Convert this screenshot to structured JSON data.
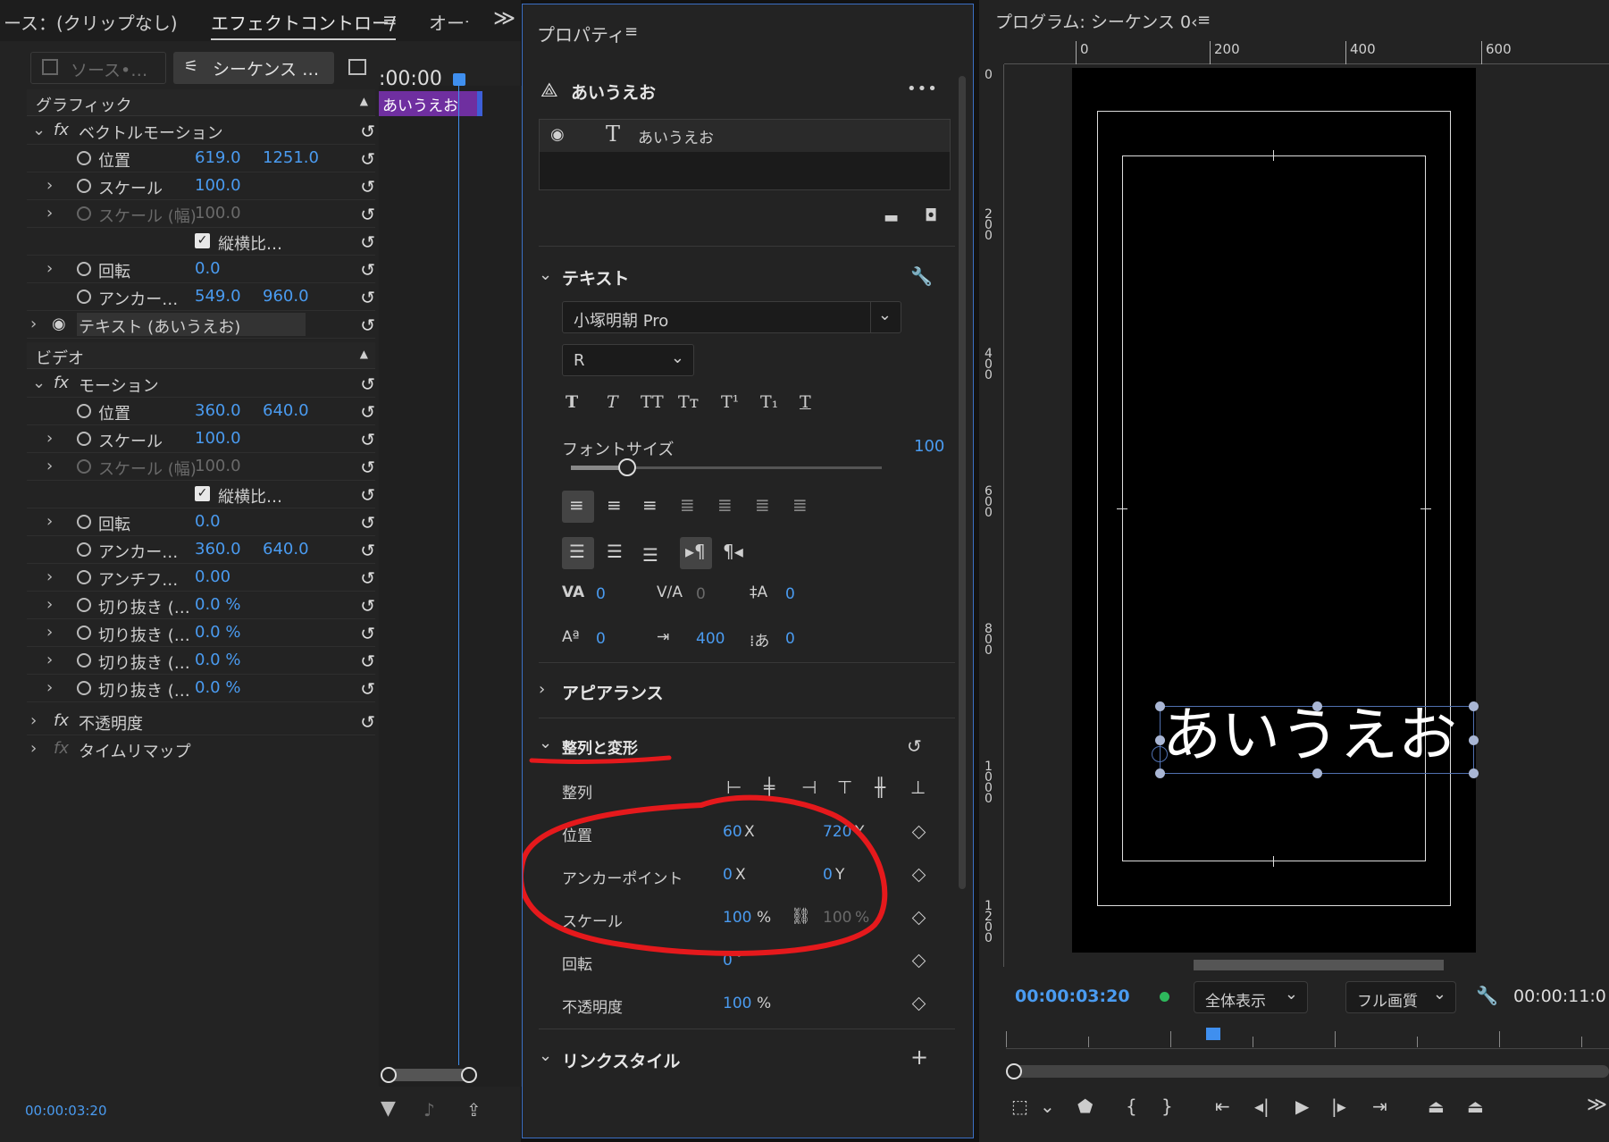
{
  "left": {
    "tab_source": "ース：(クリップなし)",
    "tab_effect": "エフェクトコントロー/",
    "tab_audio": "オーディ",
    "more": "≫",
    "menu": "≡",
    "source_btn": "ソース•…",
    "sequence_btn": "シーケンス …",
    "timecode_top": ":00:00",
    "clip_label": "あいうえお",
    "section_graphic": "グラフィック",
    "vector_motion": "ベクトルモーション",
    "g_position": "位置",
    "g_pos_x": "619.0",
    "g_pos_y": "1251.0",
    "g_scale": "スケール",
    "g_scale_v": "100.0",
    "g_scale_w": "スケール (幅)",
    "g_scale_w_v": "100.0",
    "g_aspect": "縦横比…",
    "g_rotation": "回転",
    "g_rotation_v": "0.0",
    "g_anchor": "アンカー…",
    "g_anchor_x": "549.0",
    "g_anchor_y": "960.0",
    "text_layer": "テキスト (あいうえお)",
    "section_video": "ビデオ",
    "motion": "モーション",
    "v_position": "位置",
    "v_pos_x": "360.0",
    "v_pos_y": "640.0",
    "v_scale": "スケール",
    "v_scale_v": "100.0",
    "v_scale_w": "スケール (幅)",
    "v_scale_w_v": "100.0",
    "v_aspect": "縦横比…",
    "v_rotation": "回転",
    "v_rotation_v": "0.0",
    "v_anchor": "アンカー…",
    "v_anchor_x": "360.0",
    "v_anchor_y": "640.0",
    "v_antiflicker": "アンチフ…",
    "v_antiflicker_v": "0.00",
    "crop": "切り抜き (…",
    "crop_v": "0.0 %",
    "opacity": "不透明度",
    "time_remap": "タイムリマップ",
    "timecode_bottom": "00:00:03:20"
  },
  "mid": {
    "title": "プロパティ",
    "menu": "≡",
    "layer_name": "あいうえお",
    "more": "•••",
    "layer_row": "あいうえお",
    "section_text": "テキスト",
    "font": "小塚明朝 Pro",
    "font_style": "R",
    "font_size_label": "フォントサイズ",
    "font_size_value": "100",
    "font_size_fraction": 0.18,
    "kerning": "0",
    "tracking": "0",
    "leading": "0",
    "baseline": "0",
    "tsume": "400",
    "tab": "0",
    "section_appearance": "アピアランス",
    "section_align": "整列と変形",
    "align_label": "整列",
    "pos_label": "位置",
    "pos_x": "60",
    "pos_y": "720",
    "anchor_label": "アンカーポイント",
    "anchor_x": "0",
    "anchor_y": "0",
    "scale_label": "スケール",
    "scale_v": "100",
    "scale_v2": "100",
    "rot_label": "回転",
    "rot_v": "0",
    "opa_label": "不透明度",
    "opa_v": "100",
    "unit_x": "X",
    "unit_y": "Y",
    "unit_pct": "%",
    "unit_deg": "°",
    "section_link": "リンクスタイル",
    "plus": "+"
  },
  "right": {
    "title": "プログラム: シーケンス 0‹",
    "menu": "≡",
    "ruler_0": "0",
    "ruler_200": "200",
    "ruler_400": "400",
    "ruler_600": "600",
    "vruler_0": "0",
    "vruler_200": "200",
    "vruler_400": "400",
    "vruler_600": "600",
    "vruler_800": "800",
    "vruler_1000": "1000",
    "vruler_1200": "1200",
    "canvas_text": "あいうえお",
    "timecode": "00:00:03:20",
    "fit": "全体表示",
    "quality": "フル画質",
    "duration": "00:00:11:0",
    "more": "≫"
  }
}
